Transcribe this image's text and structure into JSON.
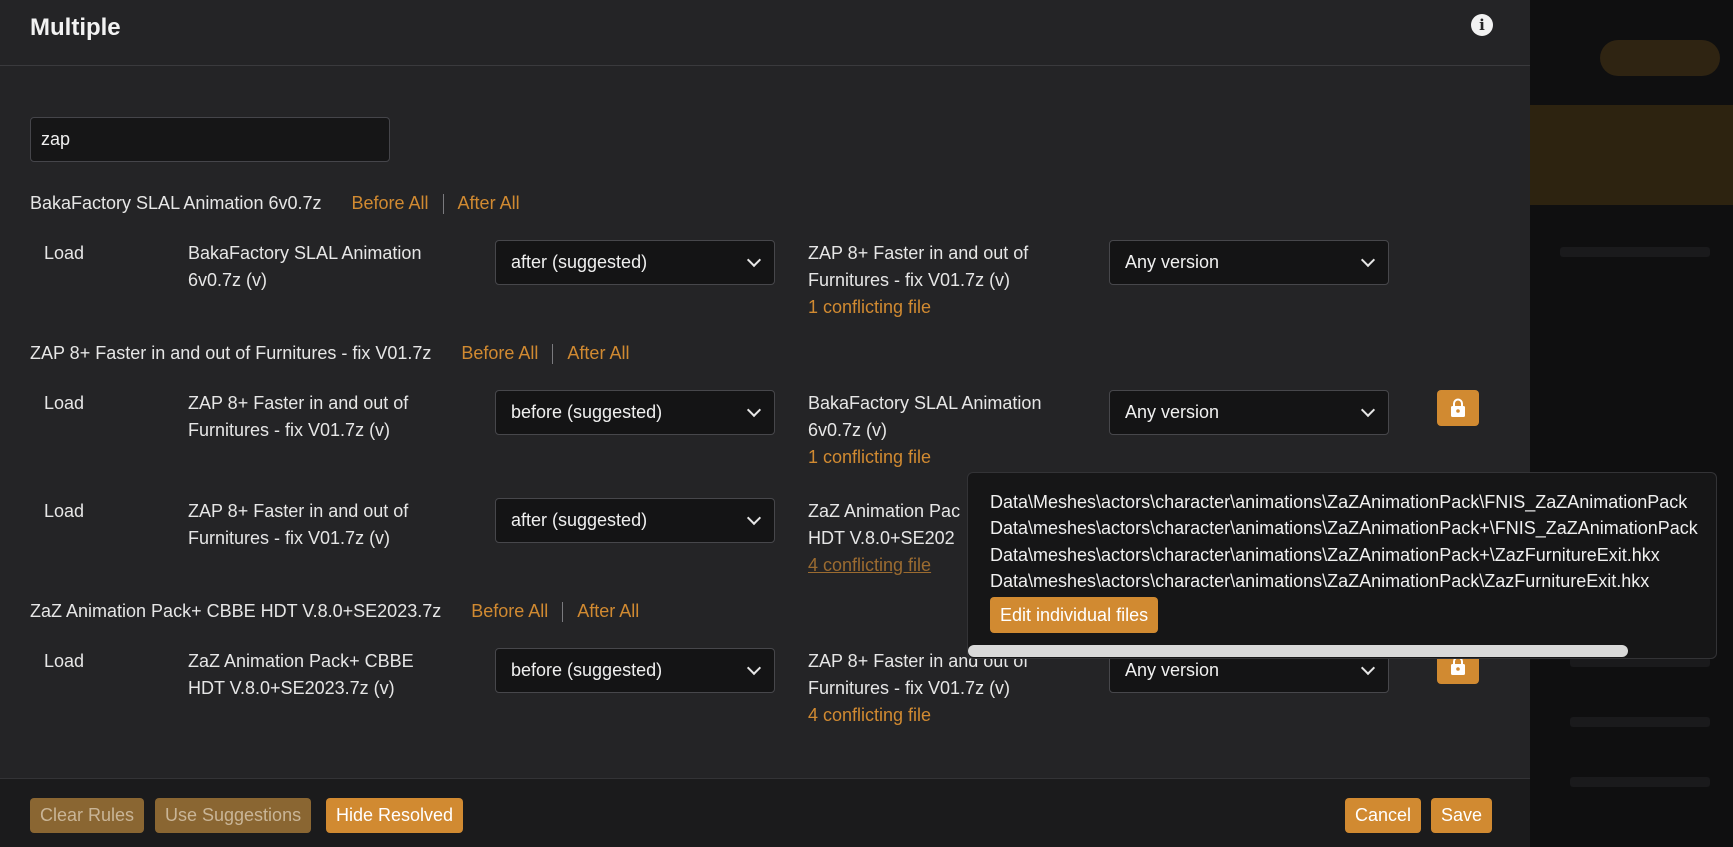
{
  "modal": {
    "title": "Multiple"
  },
  "filter": {
    "value": "zap"
  },
  "groups": [
    {
      "title": "BakaFactory SLAL Animation 6v0.7z",
      "before_all": "Before All",
      "after_all": "After All"
    },
    {
      "title": "ZAP 8+ Faster in and out of Furnitures - fix V01.7z",
      "before_all": "Before All",
      "after_all": "After All"
    },
    {
      "title": "ZaZ Animation Pack+ CBBE HDT V.8.0+SE2023.7z",
      "before_all": "Before All",
      "after_all": "After All"
    }
  ],
  "rows": [
    {
      "type": "Load",
      "source_l1": "BakaFactory SLAL Animation",
      "source_l2": "6v0.7z (v)",
      "relation": "after (suggested)",
      "ref_l1": "ZAP 8+ Faster in and out of",
      "ref_l2": "Furnitures - fix V01.7z (v)",
      "conflict": "1 conflicting file",
      "version": "Any version"
    },
    {
      "type": "Load",
      "source_l1": "ZAP 8+ Faster in and out of",
      "source_l2": "Furnitures - fix V01.7z (v)",
      "relation": "before (suggested)",
      "ref_l1": "BakaFactory SLAL Animation",
      "ref_l2": "6v0.7z (v)",
      "conflict": "1 conflicting file",
      "version": "Any version"
    },
    {
      "type": "Load",
      "source_l1": "ZAP 8+ Faster in and out of",
      "source_l2": "Furnitures - fix V01.7z (v)",
      "relation": "after (suggested)",
      "ref_l1": "ZaZ Animation Pac",
      "ref_l2": "HDT V.8.0+SE202",
      "conflict": "4 conflicting file",
      "version": ""
    },
    {
      "type": "Load",
      "source_l1": "ZaZ Animation Pack+ CBBE",
      "source_l2": "HDT V.8.0+SE2023.7z (v)",
      "relation": "before (suggested)",
      "ref_l1": "ZAP 8+ Faster in and out of",
      "ref_l2": "Furnitures - fix V01.7z (v)",
      "conflict": "4 conflicting file",
      "version": "Any version"
    }
  ],
  "popover": {
    "files": [
      "Data\\Meshes\\actors\\character\\animations\\ZaZAnimationPack\\FNIS_ZaZAnimationPack",
      "Data\\meshes\\actors\\character\\animations\\ZaZAnimationPack+\\FNIS_ZaZAnimationPack",
      "Data\\meshes\\actors\\character\\animations\\ZaZAnimationPack+\\ZazFurnitureExit.hkx",
      "Data\\meshes\\actors\\character\\animations\\ZaZAnimationPack\\ZazFurnitureExit.hkx"
    ],
    "edit_button": "Edit individual files"
  },
  "footer": {
    "clear_rules": "Clear Rules",
    "use_suggestions": "Use Suggestions",
    "hide_resolved": "Hide Resolved",
    "cancel": "Cancel",
    "save": "Save"
  },
  "colors": {
    "accent": "#d18a31",
    "modal_bg": "#242426",
    "input_bg": "#141415"
  },
  "icons": {
    "info": "info-icon",
    "lock": "lock-icon",
    "chevron": "chevron-down-icon"
  }
}
